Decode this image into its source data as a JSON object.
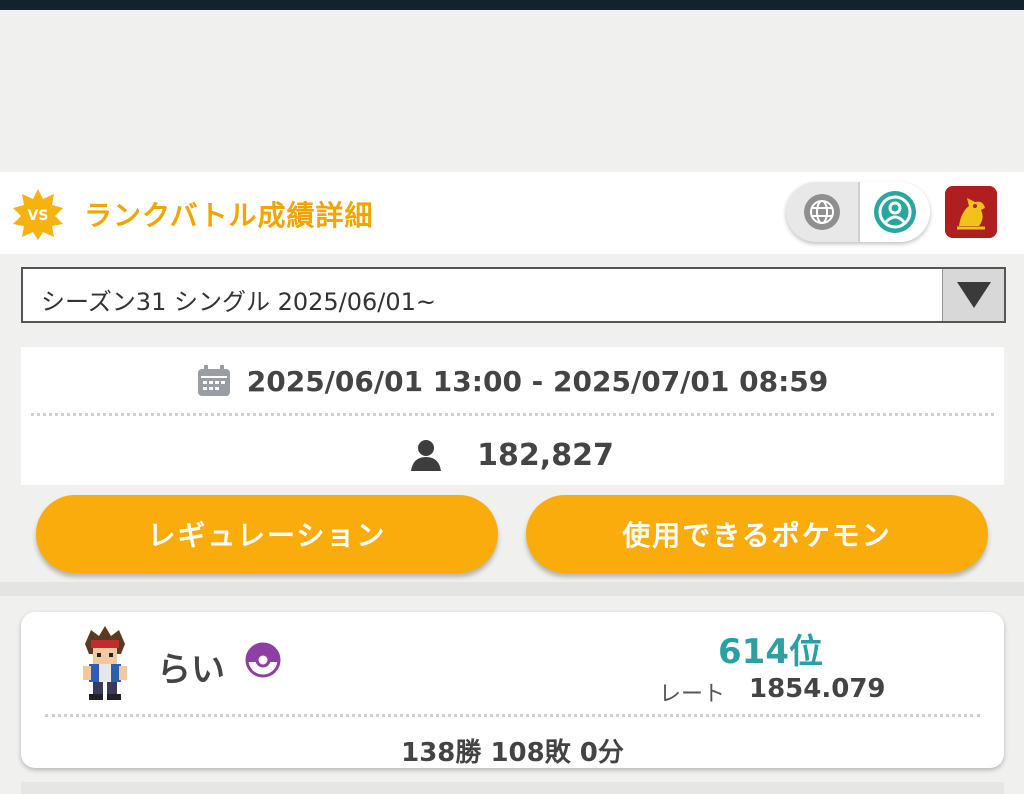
{
  "header": {
    "title": "ランクバトル成績詳細",
    "badge_text": "VS",
    "badge_color": "#f6b20f",
    "title_color": "#f0a500"
  },
  "toggle": {
    "left_icon": "globe-icon",
    "right_icon": "user-circle-icon",
    "active": "right"
  },
  "season": {
    "selected": "シーズン31 シングル 2025/06/01~"
  },
  "info": {
    "period": "2025/06/01 13:00 - 2025/07/01 08:59",
    "players": "182,827"
  },
  "buttons": {
    "regulation": "レギュレーション",
    "usable_pokemon": "使用できるポケモン",
    "color": "#fbac0d"
  },
  "player": {
    "name": "らい",
    "rank": "614位",
    "rate_label": "レート",
    "rate_value": "1854.079",
    "record": "138勝 108敗 0分",
    "rank_color": "#2aa0a3"
  }
}
